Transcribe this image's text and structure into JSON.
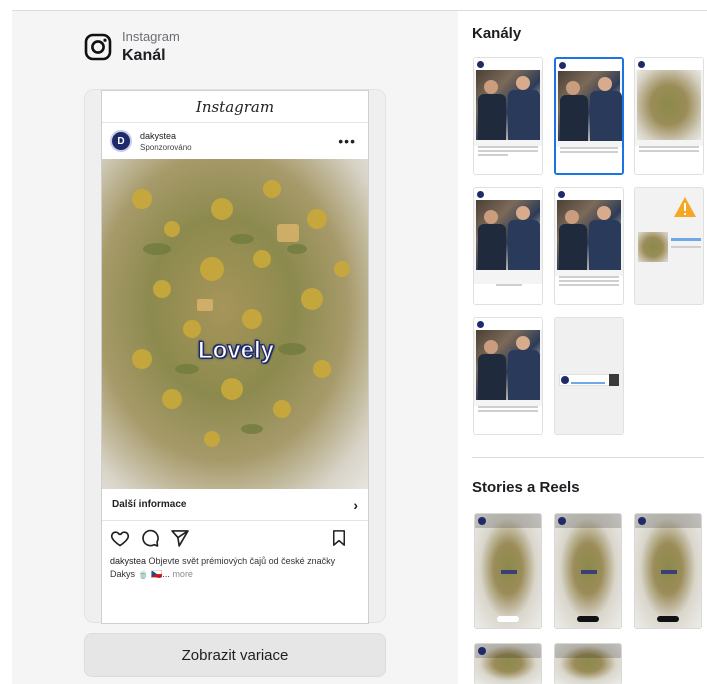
{
  "channel": {
    "platform": "Instagram",
    "title": "Kanál"
  },
  "post": {
    "app_logo": "Instagram",
    "username": "dakystea",
    "sponsored_label": "Sponzorováno",
    "avatar_letter": "D",
    "overlay_text": "Lovely",
    "cta_label": "Další informace",
    "caption_user": "dakystea",
    "caption_text": "Objevte svět prémiových čajů od české značky Dakys 🍵 🇨🇿...",
    "caption_more": "more"
  },
  "actions": {
    "variations_button": "Zobrazit variace"
  },
  "sections": {
    "channels_title": "Kanály",
    "stories_title": "Stories a Reels"
  },
  "icons": {
    "logo": "instagram-icon",
    "more": "more-horizontal-icon",
    "chevron": "chevron-right-icon",
    "like": "heart-icon",
    "comment": "comment-icon",
    "share": "send-icon",
    "save": "bookmark-icon",
    "warning": "warning-icon"
  },
  "colors": {
    "selected_border": "#1b74e4",
    "warning": "#f5a623",
    "brand_avatar": "#1f2a6b"
  }
}
